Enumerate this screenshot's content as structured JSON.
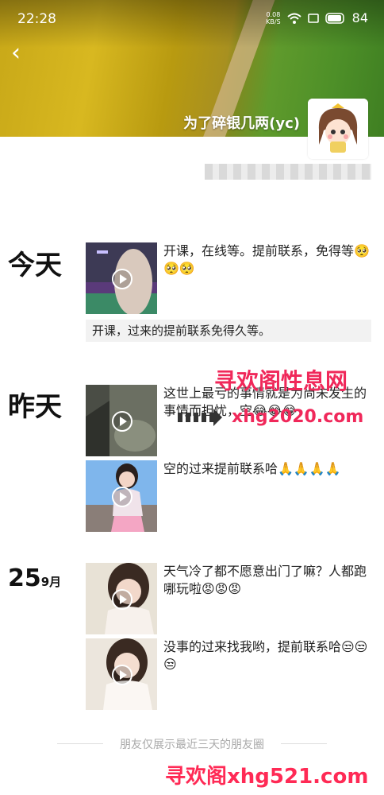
{
  "status_bar": {
    "time": "22:28",
    "speed_value": "0.08",
    "speed_unit": "KB/S",
    "battery": "84"
  },
  "profile": {
    "nickname": "为了碎银几两(yc)"
  },
  "groups": [
    {
      "date_label": "今天",
      "posts": [
        {
          "text": "开课，在线等。提前联系，免得等🥺🥺🥺"
        }
      ],
      "share_text": "开课，过来的提前联系免得久等。"
    },
    {
      "date_label": "昨天",
      "posts": [
        {
          "text": "这世上最亏的事情就是为尚未发生的事情而担忧，空😂😂😂"
        },
        {
          "text": "空的过来提前联系哈🙏🙏🙏🙏"
        }
      ]
    },
    {
      "day": "25",
      "month": "9月",
      "posts": [
        {
          "text": "天气冷了都不愿意出门了嘛？人都跑哪玩啦😡😡😡"
        },
        {
          "text": "没事的过来找我哟，提前联系哈😒😒😒"
        }
      ]
    }
  ],
  "footer": "朋友仅展示最近三天的朋友圈",
  "watermarks": {
    "site_title": "寻欢阁性息网",
    "site_url": "xhg2020.com",
    "bottom": "寻欢阁xhg521.com"
  }
}
